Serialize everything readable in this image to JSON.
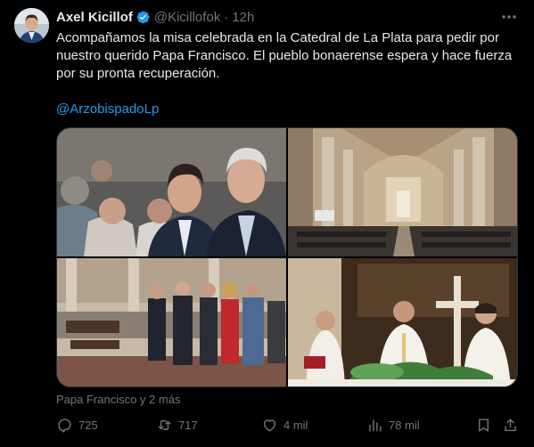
{
  "author": {
    "name": "Axel Kicillof",
    "handle": "@Kicillofok",
    "time": "12h",
    "verified": true
  },
  "tweet": {
    "text": "Acompañamos la misa celebrada en la Catedral de La Plata para pedir por nuestro querido Papa Francisco. El pueblo bonaerense espera y hace fuerza por su pronta recuperación.",
    "mention": "@ArzobispadoLp"
  },
  "media": {
    "tags": "Papa Francisco y 2 más",
    "photos": [
      "people-at-mass",
      "cathedral-interior",
      "officials-standing-in-cathedral",
      "priests-at-altar"
    ]
  },
  "actions": {
    "replies": "725",
    "reposts": "717",
    "likes": "4 mil",
    "views": "78 mil"
  },
  "colors": {
    "background": "#000000",
    "text": "#e7e9ea",
    "muted": "#71767b",
    "link": "#1d9bf0",
    "border": "#2f3336"
  }
}
